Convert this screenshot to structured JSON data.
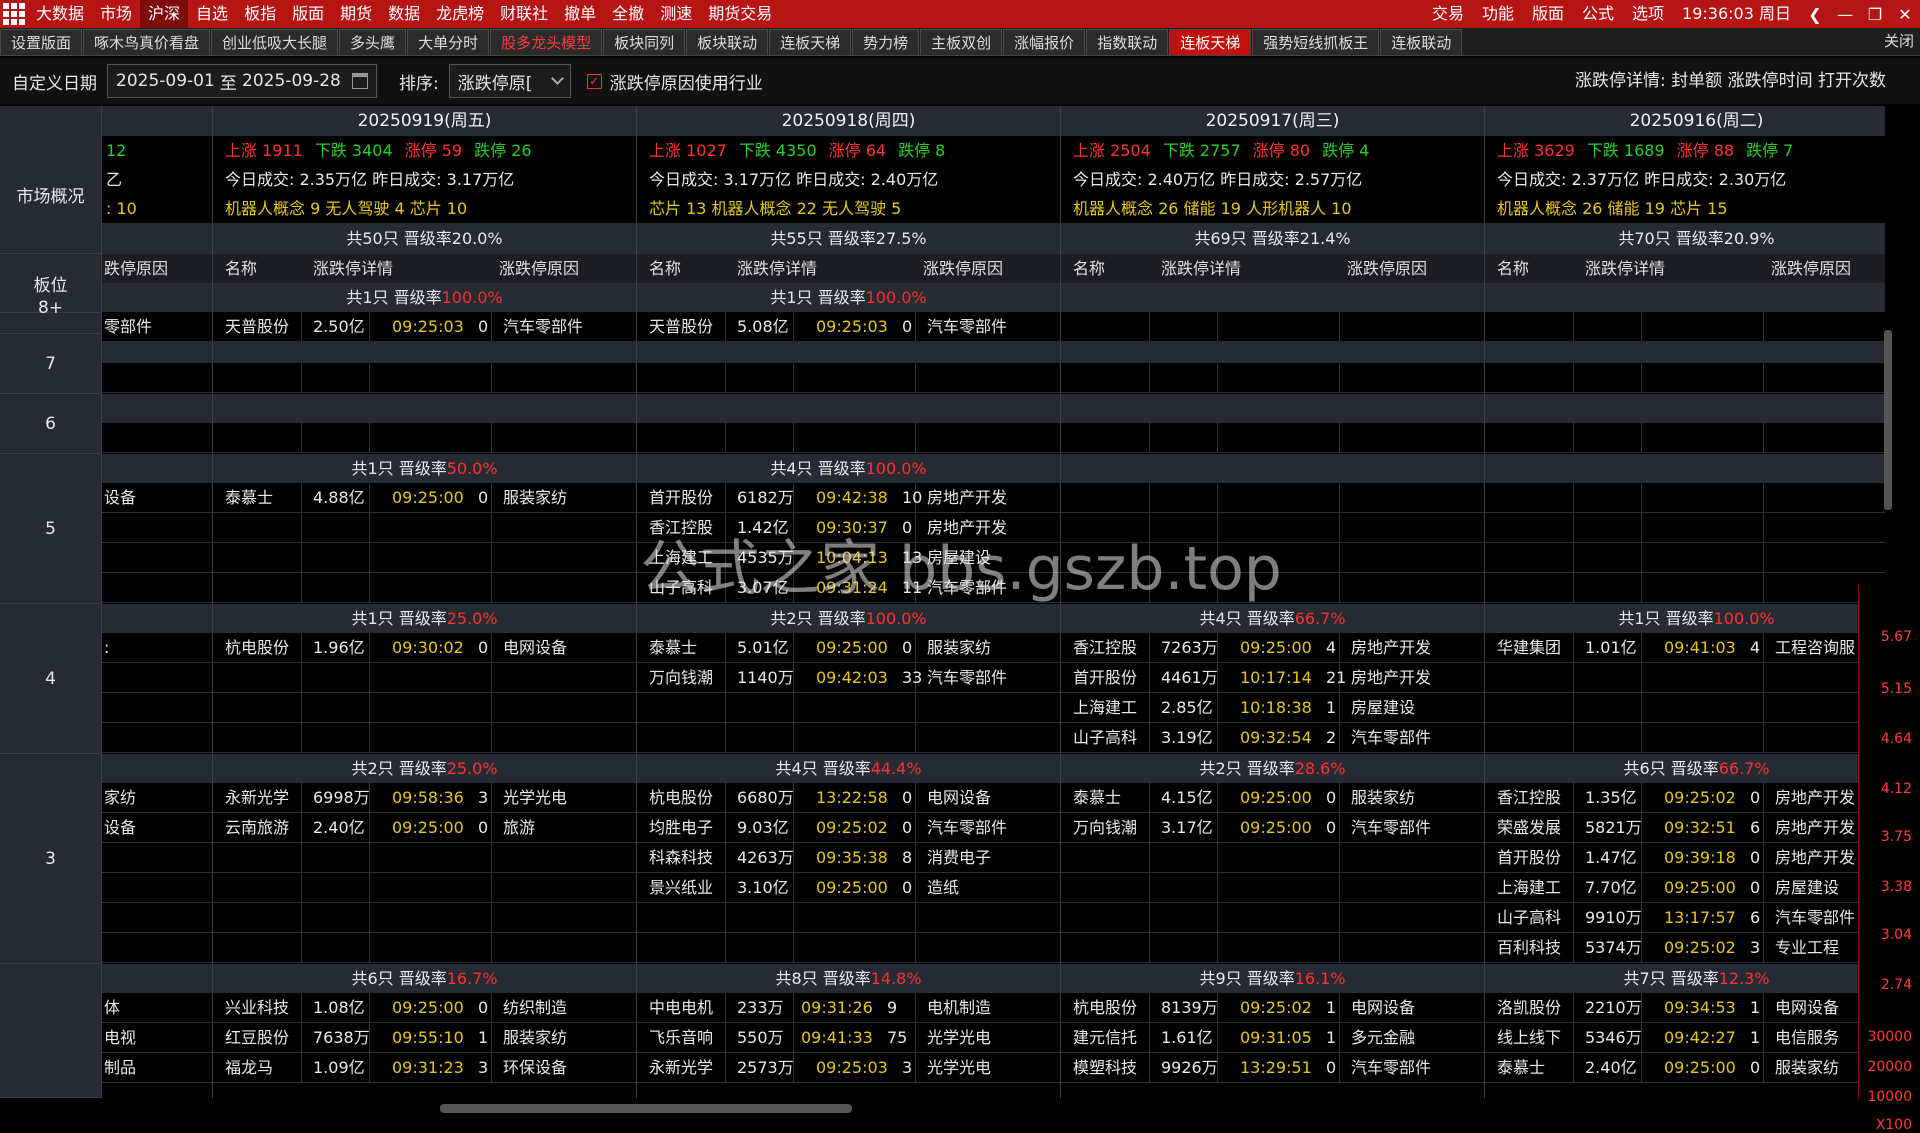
{
  "menubar": {
    "items": [
      "大数据",
      "市场",
      "沪深",
      "自选",
      "板指",
      "版面",
      "期货",
      "数据",
      "龙虎榜",
      "财联社",
      "撤单",
      "全撤",
      "测速",
      "期货交易"
    ],
    "active_index": 2,
    "right_items": [
      "交易",
      "功能",
      "版面",
      "公式",
      "选项"
    ],
    "clock": "19:36:03 周日"
  },
  "tabs": {
    "items": [
      "设置版面",
      "啄木鸟真价看盘",
      "创业低吸大长腿",
      "多头鹰",
      "大单分时",
      "股多龙头模型",
      "板块同列",
      "板块联动",
      "连板天梯",
      "势力榜",
      "主板双创",
      "涨幅报价",
      "指数联动",
      "连板天梯",
      "强势短线抓板王",
      "连板联动"
    ],
    "red_index": 5,
    "active_index": 13,
    "close_label": "关闭"
  },
  "filter": {
    "date_label": "自定义日期",
    "date_from": "2025-09-01",
    "date_sep": "至",
    "date_to": "2025-09-28",
    "sort_label": "排序:",
    "sort_value": "涨跌停原[",
    "checkbox_label": "涨跌停原因使用行业",
    "detail_label": "涨跌停详情: 封单额 涨跌停时间 打开次数"
  },
  "left": {
    "overview": "市场概况",
    "board": "板位",
    "levels": [
      "8+",
      "7",
      "6",
      "5",
      "4",
      "3"
    ]
  },
  "headers": {
    "name": "名称",
    "detail": "涨跌停详情",
    "reason": "涨跌停原因",
    "reason_partial": "跌停原因"
  },
  "partial": {
    "ov": [
      "12",
      "乙",
      ": 10"
    ],
    "sec_rows": {
      "8+": [
        "零部件"
      ],
      "5": [
        "设备"
      ],
      "4": [
        ":"
      ],
      "3": [
        "家纺",
        "设备"
      ],
      "2": [
        "体",
        "电视",
        "制品"
      ]
    }
  },
  "columns": [
    {
      "date": "20250919(周五)",
      "ov1": {
        "up": "上涨 1911",
        "down": "下跌 3404",
        "limit_up": "涨停 59",
        "limit_down": "跌停 26"
      },
      "ov2": "今日成交: 2.35万亿  昨日成交: 3.17万亿",
      "ov3": "机器人概念 9  无人驾驶 4  芯片 10",
      "total": "共50只  晋级率20.0%",
      "sections": {
        "8+": {
          "head": "共1只 晋级率",
          "rate": "100.0%",
          "rows": [
            [
              "天普股份",
              "2.50亿",
              "09:25:03",
              "0",
              "汽车零部件"
            ]
          ]
        },
        "5": {
          "head": "共1只 晋级率",
          "rate": "50.0%",
          "rows": [
            [
              "泰慕士",
              "4.88亿",
              "09:25:00",
              "0",
              "服装家纺"
            ]
          ]
        },
        "4": {
          "head": "共1只 晋级率",
          "rate": "25.0%",
          "rows": [
            [
              "杭电股份",
              "1.96亿",
              "09:30:02",
              "0",
              "电网设备"
            ]
          ]
        },
        "3": {
          "head": "共2只 晋级率",
          "rate": "25.0%",
          "rows": [
            [
              "永新光学",
              "6998万",
              "09:58:36",
              "3",
              "光学光电"
            ],
            [
              "云南旅游",
              "2.40亿",
              "09:25:00",
              "0",
              "旅游"
            ]
          ]
        },
        "2": {
          "head": "共6只 晋级率",
          "rate": "16.7%",
          "rows": [
            [
              "兴业科技",
              "1.08亿",
              "09:25:00",
              "0",
              "纺织制造"
            ],
            [
              "红豆股份",
              "7638万",
              "09:55:10",
              "1",
              "服装家纺"
            ],
            [
              "福龙马",
              "1.09亿",
              "09:31:23",
              "3",
              "环保设备"
            ]
          ]
        }
      }
    },
    {
      "date": "20250918(周四)",
      "ov1": {
        "up": "上涨 1027",
        "down": "下跌 4350",
        "limit_up": "涨停 64",
        "limit_down": "跌停 8"
      },
      "ov2": "今日成交: 3.17万亿  昨日成交: 2.40万亿",
      "ov3": "芯片 13  机器人概念 22  无人驾驶 5",
      "total": "共55只  晋级率27.5%",
      "sections": {
        "8+": {
          "head": "共1只 晋级率",
          "rate": "100.0%",
          "rows": [
            [
              "天普股份",
              "5.08亿",
              "09:25:03",
              "0",
              "汽车零部件"
            ]
          ]
        },
        "5": {
          "head": "共4只 晋级率",
          "rate": "100.0%",
          "rows": [
            [
              "首开股份",
              "6182万",
              "09:42:38",
              "10",
              "房地产开发"
            ],
            [
              "香江控股",
              "1.42亿",
              "09:30:37",
              "0",
              "房地产开发"
            ],
            [
              "上海建工",
              "4535万",
              "10:04:13",
              "13",
              "房屋建设"
            ],
            [
              "山子高科",
              "3.07亿",
              "09:31:24",
              "11",
              "汽车零部件"
            ]
          ]
        },
        "4": {
          "head": "共2只 晋级率",
          "rate": "100.0%",
          "rows": [
            [
              "泰慕士",
              "5.01亿",
              "09:25:00",
              "0",
              "服装家纺"
            ],
            [
              "万向钱潮",
              "1140万",
              "09:42:03",
              "33",
              "汽车零部件"
            ]
          ]
        },
        "3": {
          "head": "共4只 晋级率",
          "rate": "44.4%",
          "rows": [
            [
              "杭电股份",
              "6680万",
              "13:22:58",
              "0",
              "电网设备"
            ],
            [
              "均胜电子",
              "9.03亿",
              "09:25:02",
              "0",
              "汽车零部件"
            ],
            [
              "科森科技",
              "4263万",
              "09:35:38",
              "8",
              "消费电子"
            ],
            [
              "景兴纸业",
              "3.10亿",
              "09:25:00",
              "0",
              "造纸"
            ]
          ]
        },
        "2": {
          "head": "共8只 晋级率",
          "rate": "14.8%",
          "rows": [
            [
              "中电电机",
              "233万",
              "09:31:26",
              "9",
              "电机制造"
            ],
            [
              "飞乐音响",
              "550万",
              "09:41:33",
              "75",
              "光学光电"
            ],
            [
              "永新光学",
              "2573万",
              "09:25:03",
              "3",
              "光学光电"
            ]
          ]
        }
      }
    },
    {
      "date": "20250917(周三)",
      "ov1": {
        "up": "上涨 2504",
        "down": "下跌 2757",
        "limit_up": "涨停 80",
        "limit_down": "跌停 4"
      },
      "ov2": "今日成交: 2.40万亿  昨日成交: 2.57万亿",
      "ov3": "机器人概念 26  储能 19  人形机器人 10",
      "total": "共69只  晋级率21.4%",
      "sections": {
        "4": {
          "head": "共4只 晋级率",
          "rate": "66.7%",
          "rows": [
            [
              "香江控股",
              "7263万",
              "09:25:00",
              "4",
              "房地产开发"
            ],
            [
              "首开股份",
              "4461万",
              "10:17:14",
              "21",
              "房地产开发"
            ],
            [
              "上海建工",
              "2.85亿",
              "10:18:38",
              "1",
              "房屋建设"
            ],
            [
              "山子高科",
              "3.19亿",
              "09:32:54",
              "2",
              "汽车零部件"
            ]
          ]
        },
        "3": {
          "head": "共2只 晋级率",
          "rate": "28.6%",
          "rows": [
            [
              "泰慕士",
              "4.15亿",
              "09:25:00",
              "0",
              "服装家纺"
            ],
            [
              "万向钱潮",
              "3.17亿",
              "09:25:00",
              "0",
              "汽车零部件"
            ]
          ]
        },
        "2": {
          "head": "共9只 晋级率",
          "rate": "16.1%",
          "rows": [
            [
              "杭电股份",
              "8139万",
              "09:25:02",
              "1",
              "电网设备"
            ],
            [
              "建元信托",
              "1.61亿",
              "09:31:05",
              "1",
              "多元金融"
            ],
            [
              "模塑科技",
              "9926万",
              "13:29:51",
              "0",
              "汽车零部件"
            ]
          ]
        }
      }
    },
    {
      "date": "20250916(周二)",
      "ov1": {
        "up": "上涨 3629",
        "down": "下跌 1689",
        "limit_up": "涨停 88",
        "limit_down": "跌停 7"
      },
      "ov2": "今日成交: 2.37万亿  昨日成交: 2.30万亿",
      "ov3": "机器人概念 26  储能 19  芯片 15",
      "total": "共70只  晋级率20.9%",
      "sections": {
        "4": {
          "head": "共1只 晋级率",
          "rate": "100.0%",
          "rows": [
            [
              "华建集团",
              "1.01亿",
              "09:41:03",
              "4",
              "工程咨询服"
            ]
          ]
        },
        "3": {
          "head": "共6只 晋级率",
          "rate": "66.7%",
          "rows": [
            [
              "香江控股",
              "1.35亿",
              "09:25:02",
              "0",
              "房地产开发"
            ],
            [
              "荣盛发展",
              "5821万",
              "09:32:51",
              "6",
              "房地产开发"
            ],
            [
              "首开股份",
              "1.47亿",
              "09:39:18",
              "0",
              "房地产开发"
            ],
            [
              "上海建工",
              "7.70亿",
              "09:25:00",
              "0",
              "房屋建设"
            ],
            [
              "山子高科",
              "9910万",
              "13:17:57",
              "6",
              "汽车零部件"
            ],
            [
              "百利科技",
              "5374万",
              "09:25:02",
              "3",
              "专业工程"
            ]
          ]
        },
        "2": {
          "head": "共7只 晋级率",
          "rate": "12.3%",
          "rows": [
            [
              "洛凯股份",
              "2210万",
              "09:34:53",
              "1",
              "电网设备"
            ],
            [
              "线上线下",
              "5346万",
              "09:42:27",
              "1",
              "电信服务"
            ],
            [
              "泰慕士",
              "2.40亿",
              "09:25:00",
              "0",
              "服装家纺"
            ]
          ]
        }
      }
    }
  ],
  "mini_chart": {
    "labels": [
      "5.67",
      "5.15",
      "4.64",
      "4.12",
      "3.75",
      "3.38",
      "3.04",
      "2.74",
      "30000",
      "20000",
      "10000",
      "X100"
    ]
  },
  "watermark": "公式之家 bbs.gszb.top"
}
